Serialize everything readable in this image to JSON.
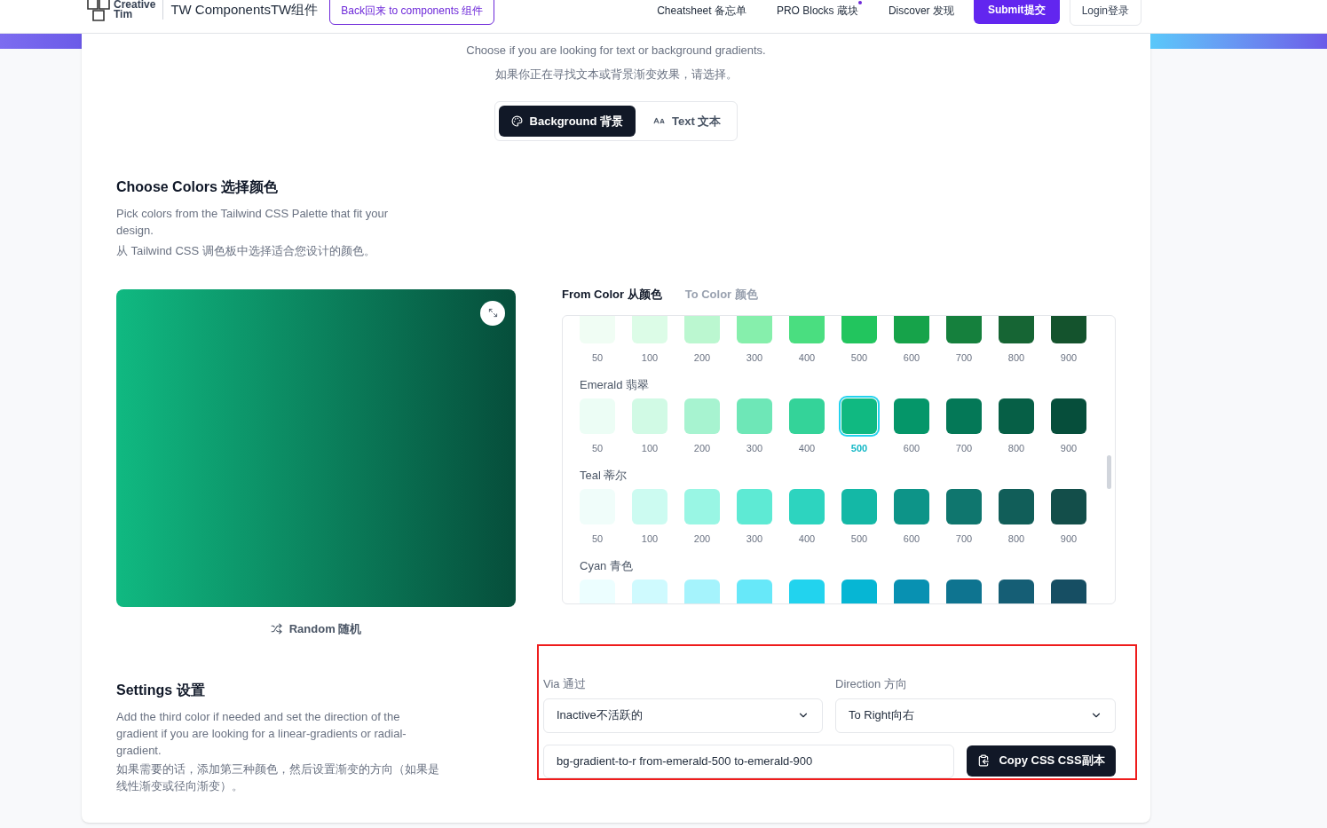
{
  "header": {
    "logo": {
      "line1": "Creative",
      "line2": "Tim"
    },
    "title": "TW ComponentsTW组件",
    "back_link": "Back回来 to components 组件",
    "nav": [
      {
        "label": "Cheatsheet 备忘单",
        "dot": false
      },
      {
        "label": "PRO Blocks 蔵块",
        "dot": true
      },
      {
        "label": "Discover 发现",
        "dot": false
      }
    ],
    "submit": "Submit提交",
    "login": "Login登录"
  },
  "intro": {
    "line1": "Choose if you are looking for text or background gradients.",
    "line2": "如果你正在寻找文本或背景渐变效果，请选择。"
  },
  "mode_tabs": [
    {
      "label": "Background 背景",
      "kind": "palette",
      "selected": true
    },
    {
      "label": "Text 文本",
      "kind": "font",
      "selected": false
    }
  ],
  "colors_section": {
    "title": "Choose Colors 选择颜色",
    "description": "Pick colors from the Tailwind CSS Palette that fit your design.",
    "description_zh": "从 Tailwind CSS 调色板中选择适合您设计的颜色。"
  },
  "random_button": "Random 随机",
  "color_tabs": [
    {
      "label": "From Color 从颜色",
      "selected": true
    },
    {
      "label": "To Color 颜色",
      "selected": false
    }
  ],
  "palettes": [
    {
      "shades": [
        {
          "label": "50",
          "color": "#f0fdf4",
          "selected": false
        },
        {
          "label": "100",
          "color": "#dcfce7",
          "selected": false
        },
        {
          "label": "200",
          "color": "#bbf7d0",
          "selected": false
        },
        {
          "label": "300",
          "color": "#86efac",
          "selected": false
        },
        {
          "label": "400",
          "color": "#4ade80",
          "selected": false
        },
        {
          "label": "500",
          "color": "#22c55e",
          "selected": false
        },
        {
          "label": "600",
          "color": "#16a34a",
          "selected": false
        },
        {
          "label": "700",
          "color": "#15803d",
          "selected": false
        },
        {
          "label": "800",
          "color": "#166534",
          "selected": false
        },
        {
          "label": "900",
          "color": "#14532d",
          "selected": false
        }
      ]
    },
    {
      "name": "Emerald 翡翠",
      "shades": [
        {
          "label": "50",
          "color": "#ecfdf5",
          "selected": false
        },
        {
          "label": "100",
          "color": "#d1fae5",
          "selected": false
        },
        {
          "label": "200",
          "color": "#a7f3d0",
          "selected": false
        },
        {
          "label": "300",
          "color": "#6ee7b7",
          "selected": false
        },
        {
          "label": "400",
          "color": "#34d399",
          "selected": false
        },
        {
          "label": "500",
          "color": "#10b981",
          "selected": true
        },
        {
          "label": "600",
          "color": "#059669",
          "selected": false
        },
        {
          "label": "700",
          "color": "#047857",
          "selected": false
        },
        {
          "label": "800",
          "color": "#065f46",
          "selected": false
        },
        {
          "label": "900",
          "color": "#064e3b",
          "selected": false
        }
      ]
    },
    {
      "name": "Teal 蒂尔",
      "shades": [
        {
          "label": "50",
          "color": "#f0fdfa",
          "selected": false
        },
        {
          "label": "100",
          "color": "#ccfbf1",
          "selected": false
        },
        {
          "label": "200",
          "color": "#99f6e4",
          "selected": false
        },
        {
          "label": "300",
          "color": "#5eead4",
          "selected": false
        },
        {
          "label": "400",
          "color": "#2dd4bf",
          "selected": false
        },
        {
          "label": "500",
          "color": "#14b8a6",
          "selected": false
        },
        {
          "label": "600",
          "color": "#0d9488",
          "selected": false
        },
        {
          "label": "700",
          "color": "#0f766e",
          "selected": false
        },
        {
          "label": "800",
          "color": "#115e59",
          "selected": false
        },
        {
          "label": "900",
          "color": "#134e4a",
          "selected": false
        }
      ]
    },
    {
      "name": "Cyan 青色",
      "shades": [
        {
          "color": "#ecfeff",
          "selected": false
        },
        {
          "color": "#cffafe",
          "selected": false
        },
        {
          "color": "#a5f3fc",
          "selected": false
        },
        {
          "color": "#67e8f9",
          "selected": false
        },
        {
          "color": "#22d3ee",
          "selected": false
        },
        {
          "color": "#06b6d4",
          "selected": false
        },
        {
          "color": "#0891b2",
          "selected": false
        },
        {
          "color": "#0e7490",
          "selected": false
        },
        {
          "color": "#155e75",
          "selected": false
        },
        {
          "color": "#164e63",
          "selected": false
        }
      ]
    }
  ],
  "settings_section": {
    "title": "Settings 设置",
    "description": "Add the third color if needed and set the direction of the gradient if you are looking for a linear-gradients or radial-gradient.",
    "description_zh": "如果需要的话，添加第三种颜色，然后设置渐变的方向（如果是线性渐变或径向渐变）。"
  },
  "via": {
    "label": "Via 通过",
    "value": "Inactive不活跃的"
  },
  "direction": {
    "label": "Direction 方向",
    "value": "To Right向右"
  },
  "css_output": {
    "value": "bg-gradient-to-r from-emerald-500 to-emerald-900"
  },
  "copy_button": "Copy CSS CSS副本"
}
